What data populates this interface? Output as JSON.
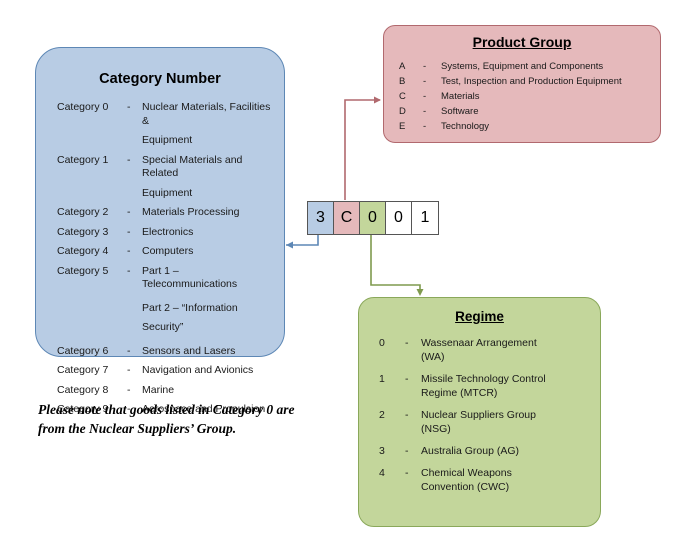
{
  "category_box": {
    "title": "Category Number",
    "items": [
      {
        "label": "Category 0",
        "dash": "-",
        "lines": [
          "Nuclear Materials, Facilities &",
          "Equipment"
        ]
      },
      {
        "label": "Category 1",
        "dash": "-",
        "lines": [
          "Special Materials and Related",
          "Equipment"
        ]
      },
      {
        "label": "Category 2",
        "dash": "-",
        "lines": [
          "Materials Processing"
        ]
      },
      {
        "label": "Category 3",
        "dash": "-",
        "lines": [
          "Electronics"
        ]
      },
      {
        "label": "Category 4",
        "dash": "-",
        "lines": [
          "Computers"
        ]
      },
      {
        "label": "Category 5",
        "dash": "-",
        "lines": [
          "Part 1 – Telecommunications",
          "Part 2 – “Information",
          "Security”"
        ]
      },
      {
        "label": "Category 6",
        "dash": "-",
        "lines": [
          "Sensors and Lasers"
        ]
      },
      {
        "label": "Category 7",
        "dash": "-",
        "lines": [
          "Navigation and Avionics"
        ]
      },
      {
        "label": "Category 8",
        "dash": "-",
        "lines": [
          "Marine"
        ]
      },
      {
        "label": "Category 9",
        "dash": "-",
        "lines": [
          "Aerospace and Propulsion"
        ]
      }
    ]
  },
  "note": "Please note that goods listed in Category 0 are from the Nuclear Suppliers’ Group.",
  "product_group": {
    "title": "Product Group",
    "items": [
      {
        "letter": "A",
        "dash": "-",
        "desc": "Systems, Equipment and Components"
      },
      {
        "letter": "B",
        "dash": "-",
        "desc": "Test, Inspection and Production Equipment"
      },
      {
        "letter": "C",
        "dash": "-",
        "desc": "Materials"
      },
      {
        "letter": "D",
        "dash": "-",
        "desc": "Software"
      },
      {
        "letter": "E",
        "dash": "-",
        "desc": "Technology"
      }
    ]
  },
  "regime": {
    "title": "Regime",
    "items": [
      {
        "num": "0",
        "dash": "-",
        "lines": [
          "Wassenaar Arrangement",
          "(WA)"
        ]
      },
      {
        "num": "1",
        "dash": "-",
        "lines": [
          "Missile Technology Control",
          "Regime (MTCR)"
        ]
      },
      {
        "num": "2",
        "dash": "-",
        "lines": [
          "Nuclear Suppliers Group",
          "(NSG)"
        ]
      },
      {
        "num": "3",
        "dash": "-",
        "lines": [
          "Australia Group (AG)"
        ]
      },
      {
        "num": "4",
        "dash": "-",
        "lines": [
          "Chemical Weapons",
          "Convention (CWC)"
        ]
      }
    ]
  },
  "code": {
    "cells": [
      {
        "char": "3",
        "fill": "blue"
      },
      {
        "char": "C",
        "fill": "pink"
      },
      {
        "char": "0",
        "fill": "green"
      },
      {
        "char": "0",
        "fill": "white"
      },
      {
        "char": "1",
        "fill": "white"
      }
    ]
  },
  "colors": {
    "category_fill": "#b8cce4",
    "category_stroke": "#5d87b5",
    "product_fill": "#e5b9bb",
    "product_stroke": "#b1696e",
    "regime_fill": "#c3d69b",
    "regime_stroke": "#8aa85a"
  }
}
